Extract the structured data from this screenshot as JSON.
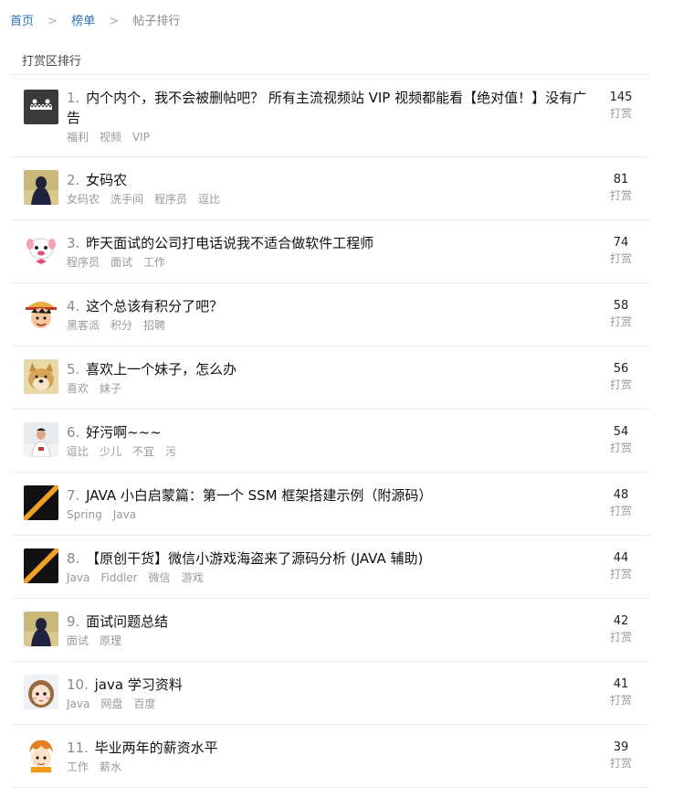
{
  "breadcrumb": {
    "home": "首页",
    "ranking": "榜单",
    "current": "帖子排行",
    "separator": ">"
  },
  "section_title": "打赏区排行",
  "score_label": "打赏",
  "posts": [
    {
      "rank": "1.",
      "title": "内个内个，我不会被删帖吧？ 所有主流视频站 VIP 视频都能看【绝对值！】没有广告",
      "tags": [
        "福利",
        "视频",
        "VIP"
      ],
      "score": "145",
      "avatar": "dark-monster"
    },
    {
      "rank": "2.",
      "title": "女码农",
      "tags": [
        "女码农",
        "洗手间",
        "程序员",
        "逗比"
      ],
      "score": "81",
      "avatar": "silhouette"
    },
    {
      "rank": "3.",
      "title": "昨天面试的公司打电话说我不适合做软件工程师",
      "tags": [
        "程序员",
        "面试",
        "工作"
      ],
      "score": "74",
      "avatar": "cartoon-dog"
    },
    {
      "rank": "4.",
      "title": "这个总该有积分了吧？",
      "tags": [
        "黑客派",
        "积分",
        "招聘"
      ],
      "score": "58",
      "avatar": "luffy"
    },
    {
      "rank": "5.",
      "title": "喜欢上一个妹子，怎么办",
      "tags": [
        "喜欢",
        "妹子"
      ],
      "score": "56",
      "avatar": "doge"
    },
    {
      "rank": "6.",
      "title": "好污啊~~~",
      "tags": [
        "逗比",
        "少儿",
        "不宜",
        "污"
      ],
      "score": "54",
      "avatar": "person"
    },
    {
      "rank": "7.",
      "title": "JAVA 小白启蒙篇：第一个 SSM 框架搭建示例（附源码）",
      "tags": [
        "Spring",
        "Java"
      ],
      "score": "48",
      "avatar": "stripe"
    },
    {
      "rank": "8.",
      "title": "【原创干货】微信小游戏海盗来了源码分析 (JAVA 辅助)",
      "tags": [
        "Java",
        "Fiddler",
        "微信",
        "游戏"
      ],
      "score": "44",
      "avatar": "stripe"
    },
    {
      "rank": "9.",
      "title": "面试问题总结",
      "tags": [
        "面试",
        "原理"
      ],
      "score": "42",
      "avatar": "silhouette"
    },
    {
      "rank": "10.",
      "title": "java 学习资料",
      "tags": [
        "Java",
        "网盘",
        "百度"
      ],
      "score": "41",
      "avatar": "girl"
    },
    {
      "rank": "11.",
      "title": "毕业两年的薪资水平",
      "tags": [
        "工作",
        "薪水"
      ],
      "score": "39",
      "avatar": "cartoon-boy"
    }
  ]
}
